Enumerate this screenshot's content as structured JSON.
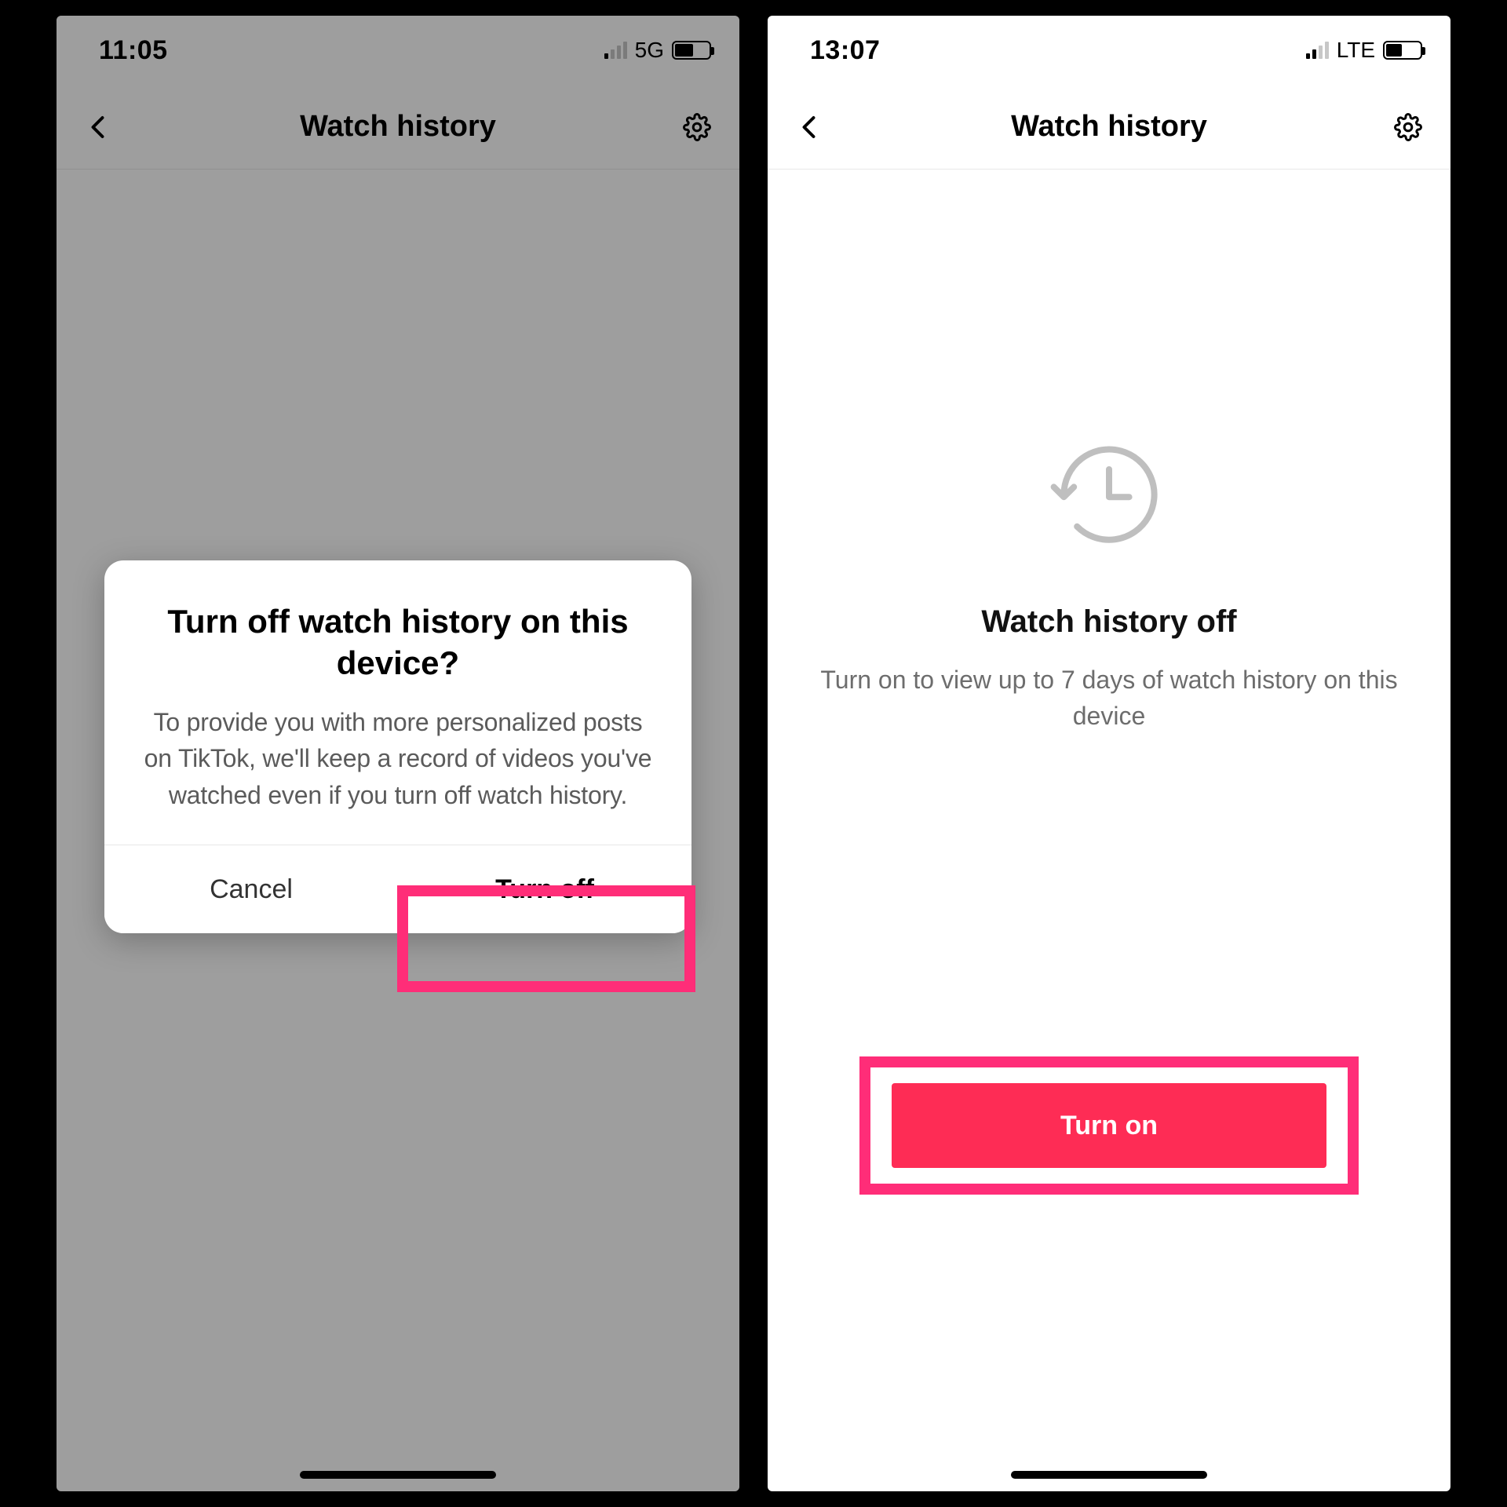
{
  "left": {
    "status": {
      "time": "11:05",
      "network": "5G",
      "signal_bars_on": 1,
      "battery_pct": 55
    },
    "nav": {
      "title": "Watch history"
    },
    "dialog": {
      "title": "Turn off watch history on this device?",
      "body": "To provide you with more personalized posts on TikTok, we'll keep a record of videos you've watched even if you turn off watch history.",
      "cancel": "Cancel",
      "confirm": "Turn off"
    }
  },
  "right": {
    "status": {
      "time": "13:07",
      "network": "LTE",
      "signal_bars_on": 2,
      "battery_pct": 48
    },
    "nav": {
      "title": "Watch history"
    },
    "empty": {
      "title": "Watch history off",
      "subtitle": "Turn on to view up to 7 days of watch history on this device"
    },
    "cta": {
      "label": "Turn on"
    }
  },
  "colors": {
    "accent": "#fe2c55",
    "highlight": "#ff2d78"
  }
}
